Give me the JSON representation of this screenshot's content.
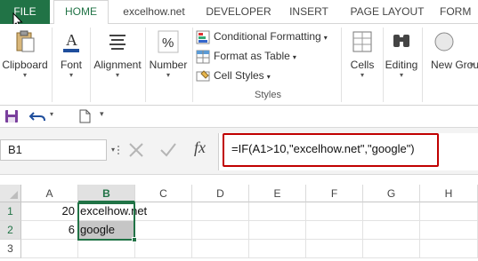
{
  "tabs": {
    "file": "FILE",
    "home": "HOME",
    "t3": "excelhow.net",
    "t4": "DEVELOPER",
    "t5": "INSERT",
    "t6": "PAGE LAYOUT",
    "t7": "FORM"
  },
  "ribbon": {
    "clipboard": "Clipboard",
    "font": "Font",
    "alignment": "Alignment",
    "number": "Number",
    "conditional_formatting": "Conditional Formatting",
    "format_as_table": "Format as Table",
    "cell_styles": "Cell Styles",
    "styles_group": "Styles",
    "cells": "Cells",
    "editing": "Editing",
    "new_group": "New Grou"
  },
  "formula_bar": {
    "name_box": "B1",
    "fx": "fx",
    "formula": "=IF(A1>10,\"excelhow.net\",\"google\")"
  },
  "grid": {
    "columns": [
      "A",
      "B",
      "C",
      "D",
      "E",
      "F",
      "G",
      "H"
    ],
    "rows": [
      "1",
      "2",
      "3"
    ],
    "a1": "20",
    "b1": "excelhow.net",
    "a2": "6",
    "b2": "google"
  },
  "colors": {
    "accent": "#217346",
    "highlight_border": "#c00000",
    "selected_cell_fill": "#c6c6c6"
  }
}
